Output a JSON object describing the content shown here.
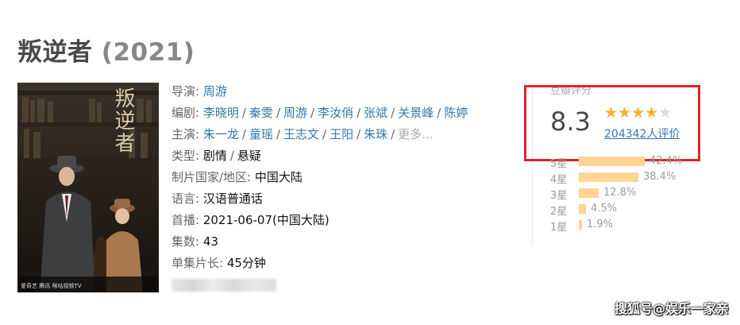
{
  "movie": {
    "title": "叛逆者",
    "year": "(2021)"
  },
  "info": {
    "director_label": "导演",
    "director": "周游",
    "writers_label": "编剧",
    "writers": [
      "李晓明",
      "秦雯",
      "周游",
      "李汝俏",
      "张斌",
      "关景峰",
      "陈婷"
    ],
    "cast_label": "主演",
    "cast": [
      "朱一龙",
      "童瑶",
      "王志文",
      "王阳",
      "朱珠"
    ],
    "cast_more": "更多...",
    "genre_label": "类型:",
    "genres": [
      "剧情",
      "悬疑"
    ],
    "country_label": "制片国家/地区:",
    "country": "中国大陆",
    "language_label": "语言:",
    "language": "汉语普通话",
    "premiere_label": "首播:",
    "premiere": "2021-06-07(中国大陆)",
    "episodes_label": "集数:",
    "episodes": "43",
    "runtime_label": "单集片长:",
    "runtime": "45分钟"
  },
  "rating": {
    "label": "豆瓣评分",
    "score": "8.3",
    "stars_filled": 4,
    "stars_total": 5,
    "votes": "204342人评价",
    "distribution": [
      {
        "label": "5星",
        "percent": 42.4,
        "text": "42.4%"
      },
      {
        "label": "4星",
        "percent": 38.4,
        "text": "38.4%"
      },
      {
        "label": "3星",
        "percent": 12.8,
        "text": "12.8%"
      },
      {
        "label": "2星",
        "percent": 4.5,
        "text": "4.5%"
      },
      {
        "label": "1星",
        "percent": 1.9,
        "text": "1.9%"
      }
    ]
  },
  "poster": {
    "title_text": "叛逆者",
    "logos": [
      "爱奇艺",
      "腾讯",
      "咪咕视频TV"
    ]
  },
  "watermark": "搜狐号@娱乐一家亲",
  "colors": {
    "link": "#3377aa",
    "star": "#ffac2d",
    "bar": "#ffd596",
    "highlight_box": "#e5202b"
  }
}
